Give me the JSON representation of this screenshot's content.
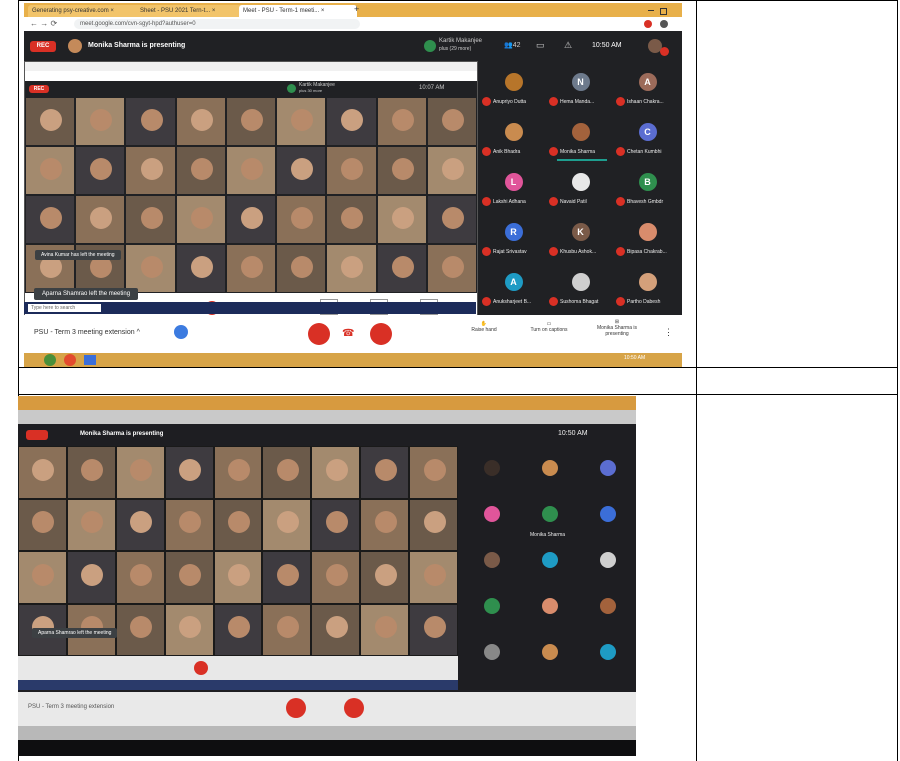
{
  "shot1": {
    "browser_tabs": [
      "Generating psy-creative.com × ",
      "Sheet - PSU 2021 Tern-t... ×",
      "Meet - PSU - Term-1 meeti... ×"
    ],
    "new_tab": "+",
    "address": "meet.google.com/cvn-sgyt-hpd?authuser=0",
    "rec_label": "REC",
    "presenting_text": "Monika Sharma is presenting",
    "presenter_name": "Kartik Makanjee",
    "presenter_sub": "plus (29 more)",
    "people_count": "42",
    "time": "10:50 AM",
    "inner": {
      "rec_label": "REC",
      "presenter_name": "Kartik Makanjee",
      "presenter_sub": "plus 30 more",
      "time": "10:07 AM"
    },
    "participants": [
      {
        "name": "Anupriyo Dutta",
        "letter": "",
        "color": "#b7752a"
      },
      {
        "name": "Hema Manda...",
        "letter": "N",
        "color": "#6d7a8c"
      },
      {
        "name": "Ishaan Chakra...",
        "letter": "A",
        "color": "#9c6b5a"
      },
      {
        "name": "Anik Bhadra",
        "letter": "",
        "color": "#c98b4f"
      },
      {
        "name": "Monika Sharma",
        "letter": "",
        "color": "#a3623c"
      },
      {
        "name": "Chetan Kumbhi",
        "letter": "C",
        "color": "#5b6dd1"
      },
      {
        "name": "Lakshi Adhana",
        "letter": "L",
        "color": "#e0559a"
      },
      {
        "name": "Navaid Patil",
        "letter": "",
        "color": "#e8e8e8"
      },
      {
        "name": "Bhavesh Gmbdr",
        "letter": "B",
        "color": "#2f8f4e"
      },
      {
        "name": "Rajat Srivastav",
        "letter": "R",
        "color": "#3b6ed8"
      },
      {
        "name": "Khusbu Ashok...",
        "letter": "K",
        "color": "#7a5a48"
      },
      {
        "name": "Bipasa Chakrab...",
        "letter": "",
        "color": "#d98c6c"
      },
      {
        "name": "Anuksharjeet B...",
        "letter": "A",
        "color": "#1e9bc4"
      },
      {
        "name": "Sushoma Bhagat",
        "letter": "",
        "color": "#cfcfcf"
      },
      {
        "name": "Partho Dabesh",
        "letter": "",
        "color": "#d4a07a"
      }
    ],
    "toast_joined": "Avina Kumar has left the meeting",
    "toast_left": "Aparna Shamrao left the meeting",
    "meeting_name": "PSU - Term 3 meeting extension",
    "caret": "^",
    "raise_hand": "Raise hand",
    "turn_on_captions": "Turn on captions",
    "presenting_label": "Monika Sharma is presenting",
    "more": "⋮",
    "taskbar_time": "10:50 AM",
    "search_placeholder": "Type here to search"
  },
  "shot2": {
    "presenting_text": "Monika Sharma is presenting",
    "time": "10:50 AM",
    "presenter_label": "Monika Sharma",
    "meeting_name": "PSU - Term 3 meeting extension",
    "letters": [
      "N",
      "A",
      "C",
      "L",
      "B",
      "R",
      "K",
      "A"
    ],
    "toast": "Aparna Shamrao left the meeting"
  }
}
